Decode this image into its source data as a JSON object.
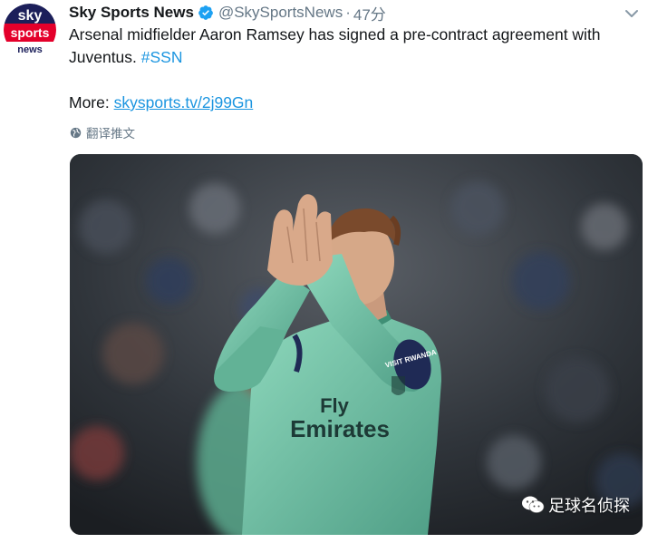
{
  "account": {
    "display_name": "Sky Sports News",
    "handle": "@SkySportsNews",
    "separator": "·",
    "time": "47分",
    "avatar_icon": "sky-sports-news-logo",
    "avatar_lines": [
      "sky",
      "sports",
      "news"
    ]
  },
  "tweet": {
    "text": "Arsenal midfielder Aaron Ramsey has signed a pre-contract agreement with Juventus.",
    "hashtag": "#SSN",
    "more_label": "More:",
    "link": "skysports.tv/2j99Gn",
    "translate_label": "翻译推文"
  },
  "photo": {
    "shirt_sponsor_line1": "Fly",
    "shirt_sponsor_line2": "Emirates",
    "sleeve_badge": "VISIT RWANDA"
  },
  "watermark": {
    "text": "足球名侦探"
  },
  "colors": {
    "link": "#1b95e0",
    "secondary_text": "#657786",
    "primary_text": "#14171a",
    "sky_red": "#e4002b",
    "sky_blue": "#1c1f5a",
    "kit_green": "#73c7a8"
  }
}
